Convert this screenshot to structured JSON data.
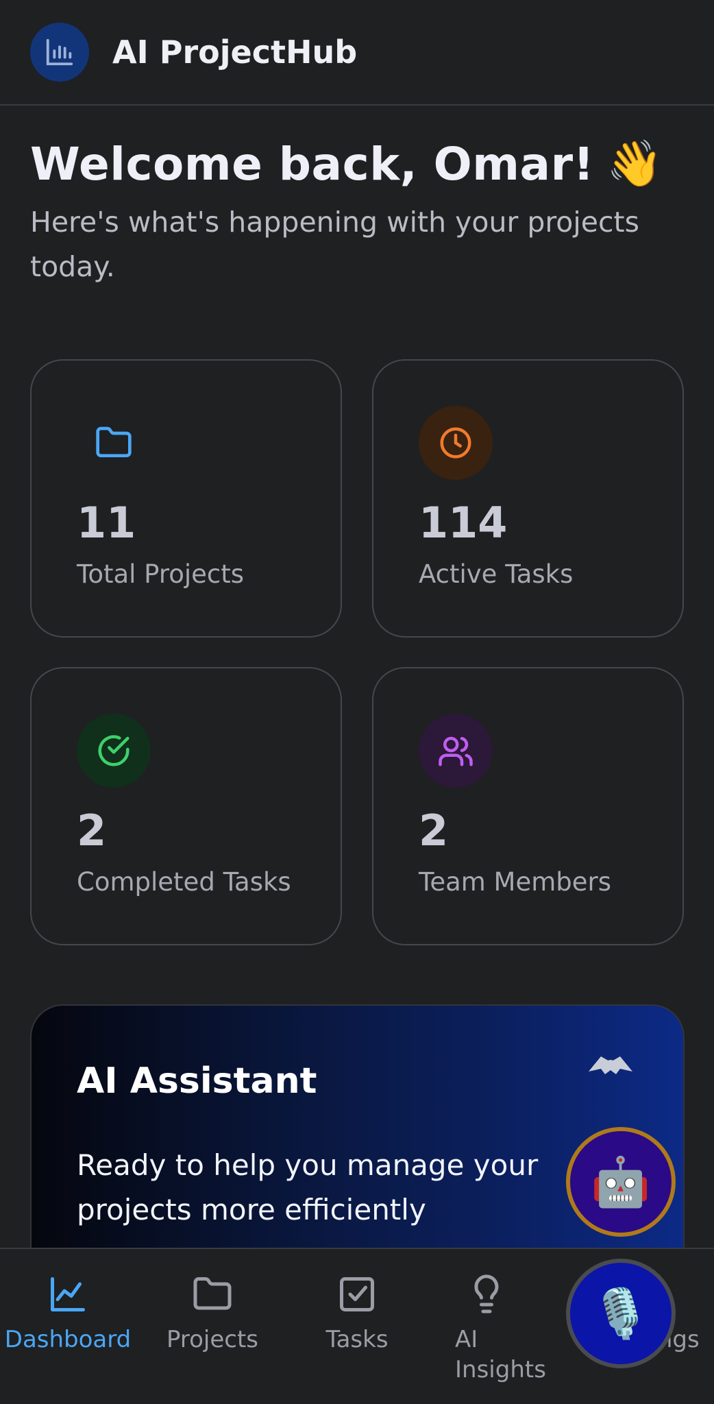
{
  "header": {
    "app_title": "AI ProjectHub",
    "logo_icon": "bar-chart-icon"
  },
  "welcome": {
    "title": "Welcome back, Omar!",
    "emoji": "👋",
    "subtitle": "Here's what's happening with your projects today."
  },
  "stats": [
    {
      "value": "11",
      "label": "Total Projects",
      "icon": "folder-icon",
      "color": "#4aa7f5"
    },
    {
      "value": "114",
      "label": "Active Tasks",
      "icon": "clock-icon",
      "color": "#f07a2e"
    },
    {
      "value": "2",
      "label": "Completed Tasks",
      "icon": "check-circle-icon",
      "color": "#3fcf6a"
    },
    {
      "value": "2",
      "label": "Team Members",
      "icon": "users-icon",
      "color": "#c05ef0"
    }
  ],
  "assistant": {
    "title": "AI Assistant",
    "description": "Ready to help you manage your projects more efficiently",
    "robot_emoji": "🤖",
    "mic_emoji": "🎙️"
  },
  "nav": {
    "items": [
      {
        "label": "Dashboard",
        "icon": "line-chart-icon",
        "active": true
      },
      {
        "label": "Projects",
        "icon": "folder-icon",
        "active": false
      },
      {
        "label": "Tasks",
        "icon": "checkbox-icon",
        "active": false
      },
      {
        "label": "AI Insights",
        "icon": "lightbulb-icon",
        "active": false
      },
      {
        "label": "Settings",
        "icon": "gear-icon",
        "active": false
      }
    ]
  },
  "colors": {
    "background": "#1f2022",
    "accent": "#4aa7f5"
  }
}
